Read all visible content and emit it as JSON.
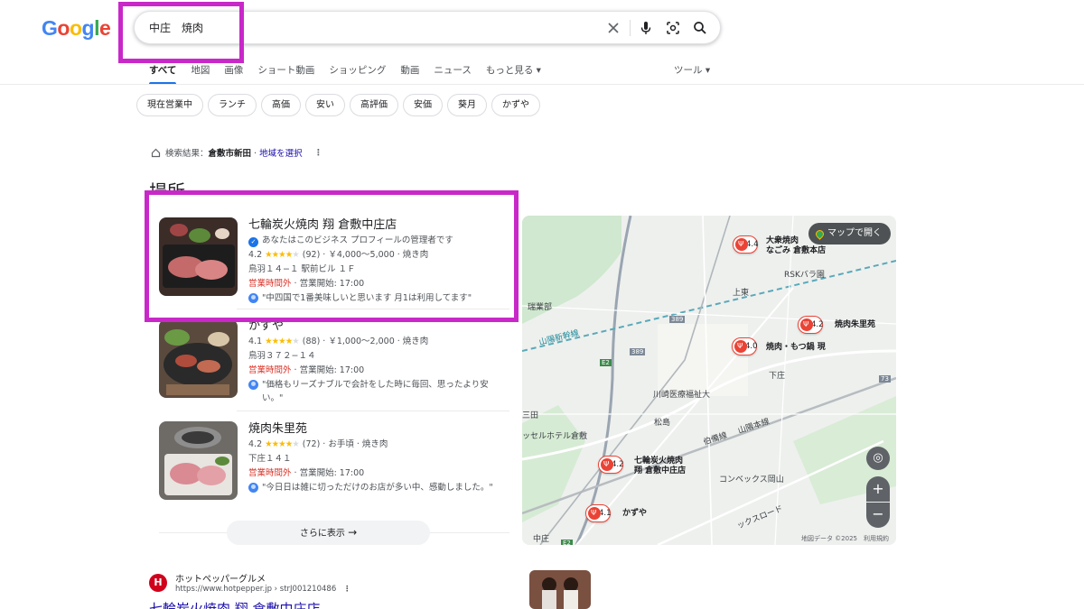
{
  "logo": {
    "letters": [
      "G",
      "o",
      "o",
      "g",
      "l",
      "e"
    ],
    "colors": [
      "#4285f4",
      "#ea4335",
      "#fbbc05",
      "#4285f4",
      "#34a853",
      "#ea4335"
    ]
  },
  "search": {
    "query": "中庄　焼肉"
  },
  "icons": {
    "clear": "close-icon",
    "voice": "mic-icon",
    "lens": "lens-icon",
    "search": "search-icon"
  },
  "tabs": [
    "すべて",
    "地図",
    "画像",
    "ショート動画",
    "ショッピング",
    "動画",
    "ニュース",
    "もっと見る ▾"
  ],
  "tools": "ツール ▾",
  "chips": [
    "現在営業中",
    "ランチ",
    "高価",
    "安い",
    "高評価",
    "安価",
    "葵月",
    "かずや"
  ],
  "location": {
    "prefix": "検索結果：",
    "area": "倉敷市新田",
    "dot": " · ",
    "link": "地域を選択"
  },
  "section_title": "場所",
  "places": [
    {
      "name": "七輪炭火焼肉 翔 倉敷中庄店",
      "owner_note": "あなたはこのビジネス プロフィールの管理者です",
      "rating": "4.2",
      "stars": "★★★★",
      "empty_star": "★",
      "meta": "(92) · ￥4,000〜5,000 · 焼き肉",
      "address": "鳥羽１４−１ 駅前ビル １Ｆ",
      "status": "営業時間外",
      "hours": " · 営業開始: 17:00",
      "review": "\"中四国で1番美味しいと思います 月1は利用してます\""
    },
    {
      "name": "かずや",
      "rating": "4.1",
      "stars": "★★★★",
      "empty_star": "★",
      "meta": "(88) · ￥1,000〜2,000 · 焼き肉",
      "address": "鳥羽３７２−１４",
      "status": "営業時間外",
      "hours": " · 営業開始: 17:00",
      "review": "\"価格もリーズナブルで会計をした時に毎回、思ったより安い。\""
    },
    {
      "name": "焼肉朱里苑",
      "rating": "4.2",
      "stars": "★★★★",
      "empty_star": "★",
      "meta": "(72) · お手頃 · 焼き肉",
      "address": "下庄１４１",
      "status": "営業時間外",
      "hours": " · 営業開始: 17:00",
      "review": "\"今日日は雑に切っただけのお店が多い中、感動しました。\""
    }
  ],
  "more_button": "さらに表示",
  "map": {
    "open_label": "マップで開く",
    "labels": [
      "RSKバラ園",
      "上東",
      "下庄",
      "川崎医療福祉大",
      "松島",
      "コンベックス岡山",
      "山陽新幹線",
      "中庄",
      "三田",
      "ッセルホテル倉敷",
      "瑞業部",
      "389",
      "389",
      "73",
      "E2",
      "E2",
      "伯備線",
      "山陽本線",
      "ックスロード",
      "倉敷中庄店"
    ],
    "pins": [
      {
        "rating": "4.4",
        "name": "大衆焼肉\nなごみ 倉敷本店"
      },
      {
        "rating": "4.2",
        "name": "焼肉朱里苑"
      },
      {
        "rating": "4.0",
        "name": "焼肉・もつ鍋 現"
      },
      {
        "rating": "4.2",
        "name": "七輪炭火焼肉\n翔 倉敷中庄店"
      },
      {
        "rating": "4.1",
        "name": "かずや"
      }
    ],
    "footer": "地図データ ©2025　利用規約"
  },
  "result": {
    "site": "ホットペッパーグルメ",
    "url": "https://www.hotpepper.jp › strJ001210486",
    "title": "七輪炭火焼肉 翔 倉敷中庄店"
  }
}
